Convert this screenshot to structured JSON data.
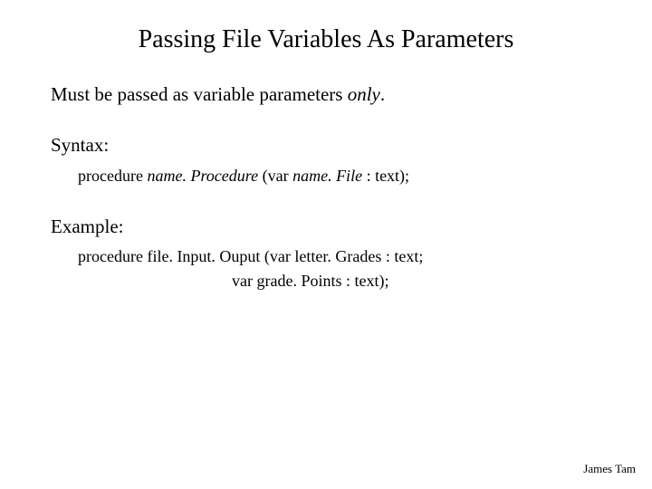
{
  "title": "Passing File Variables As Parameters",
  "intro": {
    "prefix": "Must be passed as variable parameters ",
    "only": "only",
    "suffix": "."
  },
  "syntax": {
    "heading": "Syntax:",
    "line": {
      "kw": "procedure ",
      "name": "name. Procedure",
      "mid": " (var ",
      "file": "name. File ",
      "tail": ": text);"
    }
  },
  "example": {
    "heading": "Example:",
    "line1": "procedure file. Input. Ouput (var letter. Grades : text;",
    "line2": "var grade. Points  : text);"
  },
  "footer": "James Tam"
}
